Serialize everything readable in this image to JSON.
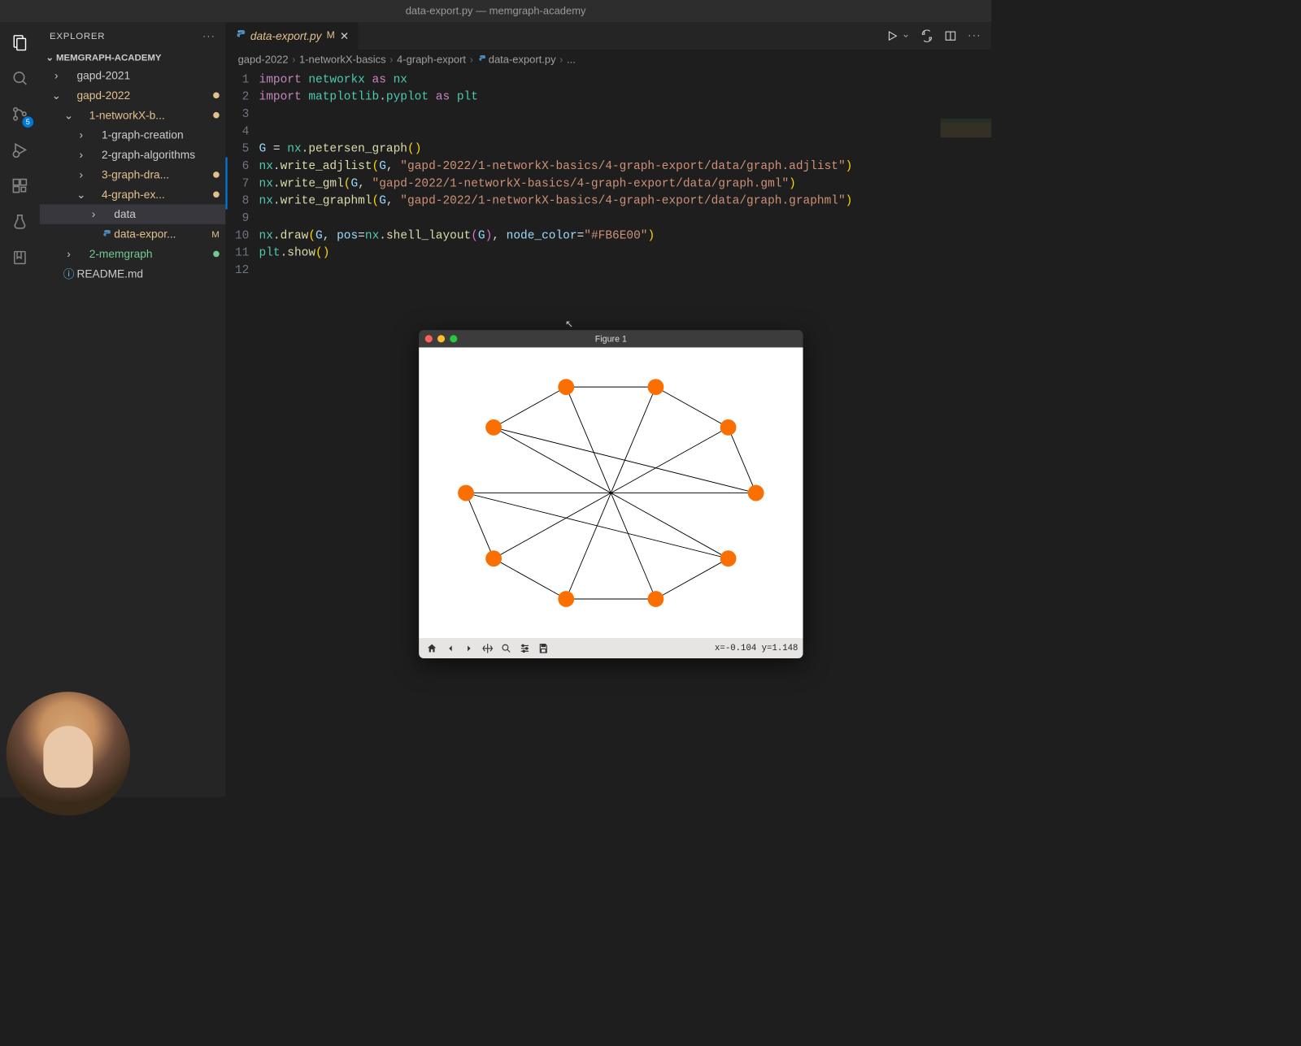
{
  "window": {
    "title": "data-export.py — memgraph-academy"
  },
  "sidebar": {
    "title": "EXPLORER",
    "project": "MEMGRAPH-ACADEMY",
    "tree": [
      {
        "label": "gapd-2021",
        "indent": 0,
        "open": false,
        "type": "folder"
      },
      {
        "label": "gapd-2022",
        "indent": 0,
        "open": true,
        "type": "folder",
        "modified": true
      },
      {
        "label": "1-networkX-b...",
        "indent": 1,
        "open": true,
        "type": "folder",
        "modified": true
      },
      {
        "label": "1-graph-creation",
        "indent": 2,
        "open": false,
        "type": "folder"
      },
      {
        "label": "2-graph-algorithms",
        "indent": 2,
        "open": false,
        "type": "folder"
      },
      {
        "label": "3-graph-dra...",
        "indent": 2,
        "open": false,
        "type": "folder",
        "modified": true
      },
      {
        "label": "4-graph-ex...",
        "indent": 2,
        "open": true,
        "type": "folder",
        "modified": true
      },
      {
        "label": "data",
        "indent": 3,
        "open": false,
        "type": "folder",
        "focused": true
      },
      {
        "label": "data-expor...",
        "indent": 3,
        "type": "py",
        "modified": true,
        "status": "M"
      },
      {
        "label": "2-memgraph",
        "indent": 1,
        "open": false,
        "type": "folder",
        "untracked": true
      },
      {
        "label": "README.md",
        "indent": 0,
        "type": "md",
        "info": true
      }
    ]
  },
  "activitybar": {
    "scm_badge": "5"
  },
  "tab": {
    "filename": "data-export.py",
    "modified_letter": "M"
  },
  "breadcrumbs": [
    "gapd-2022",
    "1-networkX-basics",
    "4-graph-export",
    "data-export.py",
    "..."
  ],
  "code": {
    "lines": [
      {
        "n": 1,
        "html": "<span class='kw'>import</span> <span class='mod'>networkx</span> <span class='kw'>as</span> <span class='mod'>nx</span>"
      },
      {
        "n": 2,
        "html": "<span class='kw'>import</span> <span class='mod'>matplotlib</span>.<span class='mod'>pyplot</span> <span class='kw'>as</span> <span class='mod'>plt</span>"
      },
      {
        "n": 3,
        "html": ""
      },
      {
        "n": 4,
        "html": ""
      },
      {
        "n": 5,
        "html": "<span class='var'>G</span> <span class='op'>=</span> <span class='mod'>nx</span>.<span class='fn'>petersen_graph</span><span class='paren'>()</span>"
      },
      {
        "n": 6,
        "html": "<span class='mod'>nx</span>.<span class='fn'>write_adjlist</span><span class='paren'>(</span><span class='var'>G</span>, <span class='str'>\"gapd-2022/1-networkX-basics/4-graph-export/data/graph.adjlist\"</span><span class='paren'>)</span>",
        "mark": true
      },
      {
        "n": 7,
        "html": "<span class='mod'>nx</span>.<span class='fn'>write_gml</span><span class='paren'>(</span><span class='var'>G</span>, <span class='str'>\"gapd-2022/1-networkX-basics/4-graph-export/data/graph.gml\"</span><span class='paren'>)</span>",
        "mark": true
      },
      {
        "n": 8,
        "html": "<span class='mod'>nx</span>.<span class='fn'>write_graphml</span><span class='paren'>(</span><span class='var'>G</span>, <span class='str'>\"gapd-2022/1-networkX-basics/4-graph-export/data/graph.graphml\"</span><span class='paren'>)</span>",
        "mark": true
      },
      {
        "n": 9,
        "html": ""
      },
      {
        "n": 10,
        "html": "<span class='mod'>nx</span>.<span class='fn'>draw</span><span class='paren'>(</span><span class='var'>G</span>, <span class='arg'>pos</span><span class='op'>=</span><span class='mod'>nx</span>.<span class='fn'>shell_layout</span><span class='paren2'>(</span><span class='var'>G</span><span class='paren2'>)</span>, <span class='arg'>node_color</span><span class='op'>=</span><span class='str'>\"#FB6E00\"</span><span class='paren'>)</span>"
      },
      {
        "n": 11,
        "html": "<span class='mod'>plt</span>.<span class='fn'>show</span><span class='paren'>()</span>"
      },
      {
        "n": 12,
        "html": ""
      }
    ]
  },
  "figure": {
    "title": "Figure 1",
    "coords": "x=-0.104 y=1.148",
    "node_color": "#FB6E00"
  },
  "chart_data": {
    "type": "graph",
    "title": "Petersen graph (networkx shell_layout)",
    "node_color": "#FB6E00",
    "nodes": [
      0,
      1,
      2,
      3,
      4,
      5,
      6,
      7,
      8,
      9
    ],
    "edges": [
      [
        0,
        1
      ],
      [
        1,
        2
      ],
      [
        2,
        3
      ],
      [
        3,
        4
      ],
      [
        4,
        0
      ],
      [
        5,
        6
      ],
      [
        6,
        7
      ],
      [
        7,
        8
      ],
      [
        8,
        9
      ],
      [
        9,
        5
      ],
      [
        0,
        5
      ],
      [
        1,
        6
      ],
      [
        2,
        7
      ],
      [
        3,
        8
      ],
      [
        4,
        9
      ]
    ],
    "positions": {
      "0": [
        1.0,
        0.0
      ],
      "1": [
        0.809,
        0.588
      ],
      "2": [
        0.309,
        0.951
      ],
      "3": [
        -0.309,
        0.951
      ],
      "4": [
        -0.809,
        0.588
      ],
      "5": [
        -1.0,
        0.0
      ],
      "6": [
        -0.809,
        -0.588
      ],
      "7": [
        -0.309,
        -0.951
      ],
      "8": [
        0.309,
        -0.951
      ],
      "9": [
        0.809,
        -0.588
      ]
    }
  }
}
